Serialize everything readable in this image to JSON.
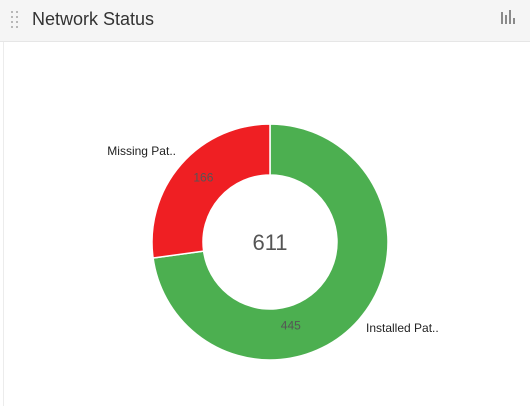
{
  "widget": {
    "title": "Network Status",
    "drag_icon": "drag-grip-icon",
    "chart_toggle_icon": "bar-chart-icon"
  },
  "colors": {
    "header_bg": "#f5f5f5",
    "missing": "#ef1f23",
    "installed": "#4caf50",
    "total_text": "#555555"
  },
  "chart_data": {
    "type": "pie",
    "style": "donut",
    "center_total": "611",
    "slices": [
      {
        "label": "Installed Pat..",
        "value": 445,
        "color": "#4caf50"
      },
      {
        "label": "Missing Pat..",
        "value": 166,
        "color": "#ef1f23"
      }
    ],
    "legend": false
  }
}
